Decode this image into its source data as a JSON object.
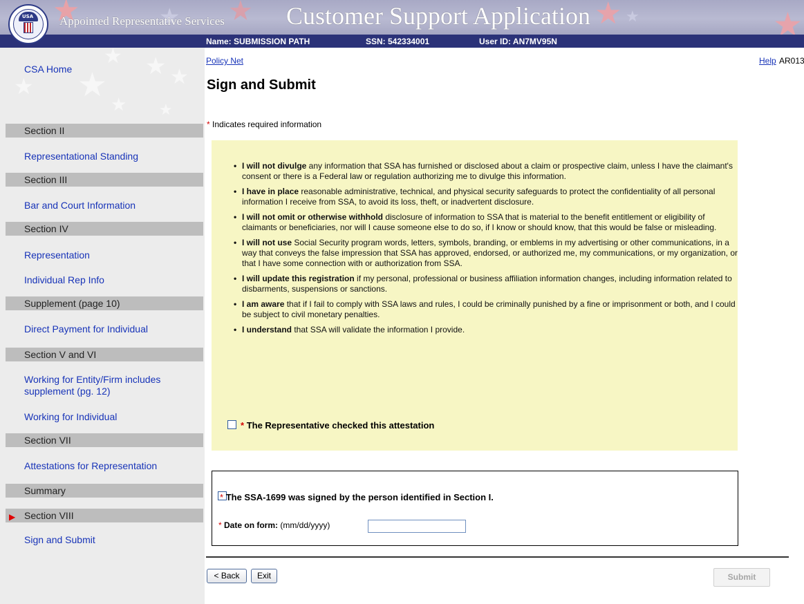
{
  "header": {
    "subtitle": "Appointed Representative Services",
    "title": "Customer Support Application",
    "info": {
      "name": "Name: SUBMISSION PATH",
      "ssn": "SSN: 542334001",
      "user_id": "User ID: AN7MV95N"
    },
    "seal_text": "USA"
  },
  "sidebar": {
    "home": "CSA Home",
    "items": [
      {
        "type": "section",
        "label": "Section II"
      },
      {
        "type": "link",
        "label": "Representational Standing"
      },
      {
        "type": "section",
        "label": "Section III"
      },
      {
        "type": "link",
        "label": "Bar and Court Information"
      },
      {
        "type": "section",
        "label": "Section IV"
      },
      {
        "type": "link",
        "label": "Representation"
      },
      {
        "type": "link",
        "label": "Individual Rep Info"
      },
      {
        "type": "section",
        "label": "Supplement (page 10)"
      },
      {
        "type": "link",
        "label": "Direct Payment for Individual"
      },
      {
        "type": "section",
        "label": "Section V and VI"
      },
      {
        "type": "link",
        "label": "Working for Entity/Firm includes supplement (pg. 12)"
      },
      {
        "type": "link",
        "label": "Working for Individual"
      },
      {
        "type": "section",
        "label": "Section VII"
      },
      {
        "type": "link",
        "label": "Attestations for Representation"
      },
      {
        "type": "section",
        "label": "Summary"
      },
      {
        "type": "section",
        "label": "Section VIII",
        "current": true
      },
      {
        "type": "link",
        "label": "Sign and Submit"
      }
    ]
  },
  "main": {
    "policy_net": "Policy Net",
    "help": "Help",
    "form_id": "AR013",
    "title": "Sign and Submit",
    "required_star": "*",
    "required_note": " Indicates required information",
    "attestations": [
      {
        "bold": "I will not divulge",
        "text": " any information that SSA has furnished or disclosed about a claim or prospective claim, unless I have the claimant's consent or there is a Federal law or regulation authorizing me to divulge this information."
      },
      {
        "bold": "I have in place",
        "text": " reasonable administrative, technical, and physical security safeguards to protect the confidentiality of all personal information I receive from SSA, to avoid its loss, theft, or inadvertent disclosure."
      },
      {
        "bold": "I will not omit or otherwise withhold",
        "text": " disclosure of information to SSA that is material to the benefit entitlement or eligibility of claimants or beneficiaries, nor will I cause someone else to do so, if I know or should know, that this would be false or misleading."
      },
      {
        "bold": "I will not use",
        "text": " Social Security program words, letters, symbols, branding, or emblems in my advertising or other communications, in a way that conveys the false impression that SSA has approved, endorsed, or authorized me, my communications, or my organization, or that I have some connection with or authorization from SSA."
      },
      {
        "bold": "I will update this registration",
        "text": " if my personal, professional or business affiliation information changes, including information related to disbarments, suspensions or sanctions."
      },
      {
        "bold": "I am aware",
        "text": " that if I fail to comply with SSA laws and rules, I could be criminally punished by a fine or imprisonment or both, and I could be subject to civil monetary penalties."
      },
      {
        "bold": "I understand",
        "text": " that SSA will validate the information I provide."
      }
    ],
    "attest_check": "The Representative checked this attestation",
    "signed_check": "The SSA-1699 was signed by the person identified in Section I.",
    "date_label": "Date on form:",
    "date_format": " (mm/dd/yyyy)",
    "date_value": "",
    "buttons": {
      "back": "< Back",
      "exit": "Exit",
      "submit": "Submit"
    }
  },
  "colors": {
    "header_bg": "#b3b4ce",
    "infobar_bg": "#2b3278",
    "link": "#1733b8",
    "attest_bg": "#f7f6c4",
    "required": "#d40000",
    "current_arrow": "#e00000"
  }
}
